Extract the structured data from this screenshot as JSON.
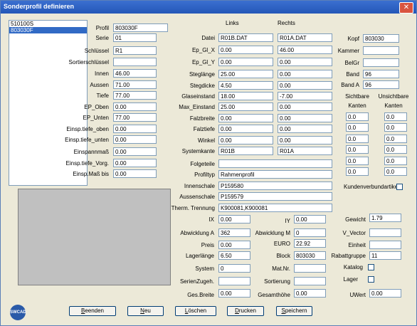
{
  "window": {
    "title": "Sonderprofil definieren",
    "close_icon": "close-icon"
  },
  "list": {
    "items": [
      "510100S",
      "803030F"
    ],
    "selected": 1
  },
  "left": {
    "profil": {
      "label": "Profil",
      "value": "803030F"
    },
    "serie": {
      "label": "Serie",
      "value": "01"
    },
    "schluessel": {
      "label": "Schlüssel",
      "value": "R1"
    },
    "sortierschluessel": {
      "label": "Sortierschlüssel",
      "value": ""
    },
    "innen": {
      "label": "Innen",
      "value": "46.00"
    },
    "aussen": {
      "label": "Aussen",
      "value": "71.00"
    },
    "tiefe": {
      "label": "Tiefe",
      "value": "77.00"
    },
    "ep_oben": {
      "label": "EP_Oben",
      "value": "0.00"
    },
    "ep_unten": {
      "label": "EP_Unten",
      "value": "77.00"
    },
    "einsp_tiefe_oben": {
      "label": "Einsp.tiefe_oben",
      "value": "0.00"
    },
    "einsp_tiefe_unten": {
      "label": "Einsp.tiefe_unten",
      "value": "0.00"
    },
    "einspannmass": {
      "label": "Einspannmaß",
      "value": "0.00"
    },
    "einsp_tiefe_vorg": {
      "label": "Einsp.tiefe_Vorg.",
      "value": "0.00"
    },
    "einsp_mass_bis": {
      "label": "Einsp.Maß bis",
      "value": "0.00"
    }
  },
  "middle": {
    "col_links": "Links",
    "col_rechts": "Rechts",
    "rows": [
      {
        "label": "Datei",
        "links": "R01B.DAT",
        "rechts": "R01A.DAT"
      },
      {
        "label": "Ep_Gl_X",
        "links": "0.00",
        "rechts": "46.00"
      },
      {
        "label": "Ep_Gl_Y",
        "links": "0.00",
        "rechts": "0.00"
      },
      {
        "label": "Steglänge",
        "links": "25.00",
        "rechts": "0.00"
      },
      {
        "label": "Stegdicke",
        "links": "4.50",
        "rechts": "0.00"
      },
      {
        "label": "Glaseinstand",
        "links": "18.00",
        "rechts": "-7.00"
      },
      {
        "label": "Max_Einstand",
        "links": "25.00",
        "rechts": "0.00"
      },
      {
        "label": "Falzbreite",
        "links": "0.00",
        "rechts": "0.00"
      },
      {
        "label": "Falztiefe",
        "links": "0.00",
        "rechts": "0.00"
      },
      {
        "label": "Winkel",
        "links": "0.00",
        "rechts": "0.00"
      },
      {
        "label": "Systemkante",
        "links": "R01B",
        "rechts": "R01A"
      }
    ],
    "folgeteile": {
      "label": "Folgeteile",
      "value": ""
    },
    "profiltyp": {
      "label": "Profiltyp",
      "value": "Rahmenprofil"
    },
    "innenschale": {
      "label": "Innenschale",
      "value": "P159580"
    },
    "aussenschale": {
      "label": "Aussenschale",
      "value": "P159579"
    },
    "therm_trennung": {
      "label": "Therm. Trennung",
      "value": "K900081,K900081"
    }
  },
  "right": {
    "kopf": {
      "label": "Kopf",
      "value": "803030"
    },
    "kammer": {
      "label": "Kammer",
      "value": ""
    },
    "belgr": {
      "label": "BelGr",
      "value": ""
    },
    "band": {
      "label": "Band",
      "value": "96"
    },
    "band_a": {
      "label": "Band A",
      "value": "96"
    },
    "sichtbare_kanten": {
      "label1": "Sichtbare",
      "label2": "Kanten"
    },
    "unsichtbare_kanten": {
      "label1": "Unsichtbare",
      "label2": "Kanten"
    },
    "kanten_rows": [
      [
        "0.0",
        "0.0"
      ],
      [
        "0.0",
        "0.0"
      ],
      [
        "0.0",
        "0.0"
      ],
      [
        "0.0",
        "0.0"
      ],
      [
        "0.0",
        "0.0"
      ],
      [
        "0.0",
        "0.0"
      ],
      [
        "0.0",
        "0.0"
      ],
      [
        "0.0",
        "0.0"
      ]
    ],
    "kundenverbundartikel": {
      "label": "Kundenverbundartikel",
      "checked": false
    }
  },
  "bottom": {
    "ix": {
      "label": "IX",
      "value": "0.00"
    },
    "iy": {
      "label": "IY",
      "value": "0.00"
    },
    "gewicht": {
      "label": "Gewicht",
      "value": "1.79"
    },
    "abwicklung_a": {
      "label": "Abwicklung A",
      "value": "362"
    },
    "abwicklung_m": {
      "label": "Abwicklung M",
      "value": "0"
    },
    "v_vector": {
      "label": "V_Vector",
      "value": ""
    },
    "preis": {
      "label": "Preis",
      "value": "0.00"
    },
    "euro": {
      "label": "EURO",
      "value": "22.92"
    },
    "einheit": {
      "label": "Einheit",
      "value": ""
    },
    "lagerlaenge": {
      "label": "Lagerlänge",
      "value": "6.50"
    },
    "block": {
      "label": "Block",
      "value": "803030"
    },
    "rabattgruppe": {
      "label": "Rabattgruppe",
      "value": "11"
    },
    "system": {
      "label": "System",
      "value": "0"
    },
    "mat_nr": {
      "label": "Mat.Nr.",
      "value": ""
    },
    "katalog": {
      "label": "Katalog",
      "checked": false
    },
    "serienzugeh": {
      "label": "SerienZugeh.",
      "value": ""
    },
    "sortierung": {
      "label": "Sortierung",
      "value": ""
    },
    "lager": {
      "label": "Lager",
      "checked": false
    },
    "ges_breite": {
      "label": "Ges.Breite",
      "value": "0.00"
    },
    "gesamthoehe": {
      "label": "Gesamthöhe",
      "value": "0.00"
    },
    "uwert": {
      "label": "UWert",
      "value": "0.00"
    }
  },
  "buttons": {
    "beenden": {
      "first": "B",
      "rest": "eenden"
    },
    "neu": {
      "first": "N",
      "rest": "eu"
    },
    "loeschen": {
      "first": "L",
      "rest": "öschen"
    },
    "drucken": {
      "first": "D",
      "rest": "rucken"
    },
    "speichern": {
      "first": "S",
      "rest": "peichern"
    }
  },
  "logo": {
    "text": "SWCAD"
  }
}
